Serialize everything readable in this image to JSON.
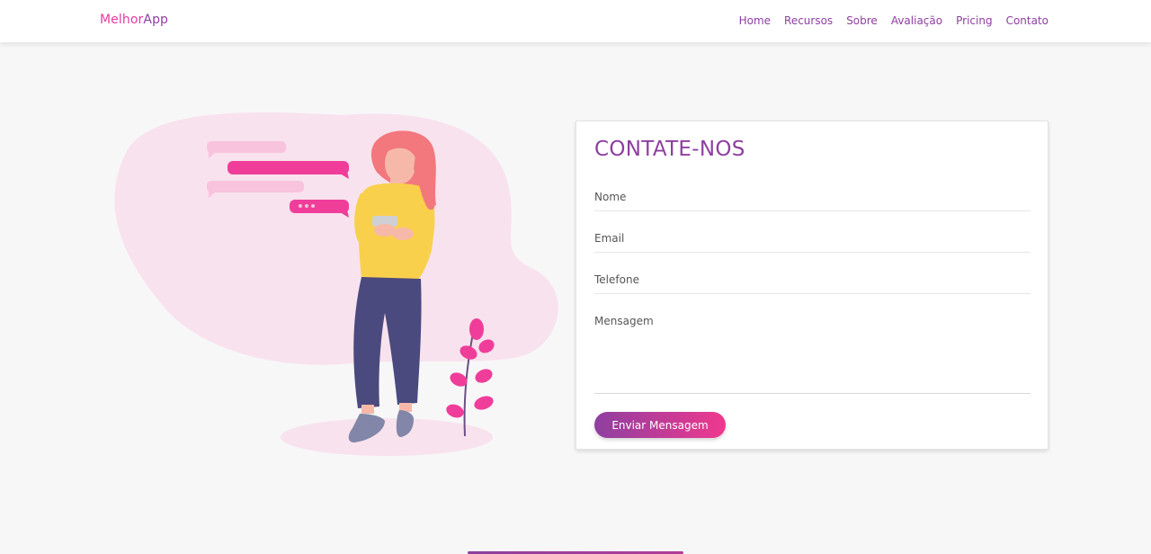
{
  "navbar": {
    "brand_part1": "Melhor",
    "brand_part2": "App",
    "links": [
      "Home",
      "Recursos",
      "Sobre",
      "Avaliação",
      "Pricing",
      "Contato"
    ]
  },
  "contact": {
    "title": "CONTATE-NOS",
    "name_placeholder": "Nome",
    "email_placeholder": "Email",
    "phone_placeholder": "Telefone",
    "message_placeholder": "Mensagem",
    "submit_label": "Enviar Mensagem"
  },
  "colors": {
    "accent_purple": "#8e3fa0",
    "accent_pink": "#f0388e",
    "background": "#f7f7f8"
  },
  "illustration": {
    "icon": "woman-texting-illustration"
  }
}
